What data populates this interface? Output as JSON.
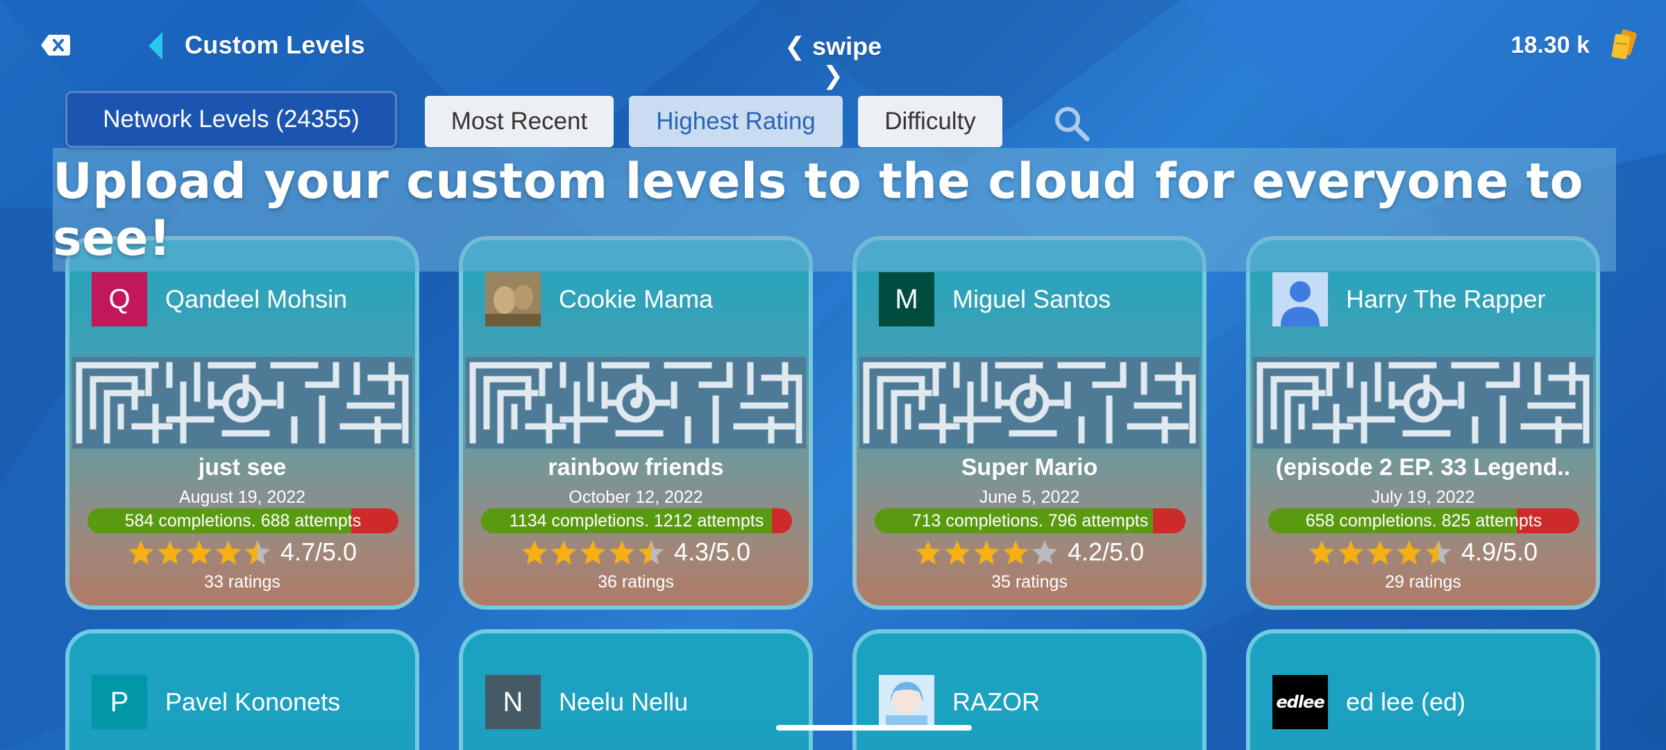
{
  "header": {
    "title": "Custom Levels",
    "swipe": "❮ swipe ❯",
    "currency": "18.30 k"
  },
  "filters": {
    "network": "Network Levels (24355)",
    "tabs": [
      {
        "label": "Most Recent",
        "active": false
      },
      {
        "label": "Highest Rating",
        "active": true
      },
      {
        "label": "Difficulty",
        "active": false
      }
    ]
  },
  "banner": "Upload your custom levels to the cloud for everyone to see!",
  "colors": {
    "accent": "#1c55b0",
    "progress_good": "#5a9a10",
    "progress_bad": "#cf2a2a",
    "star": "#f6b014"
  },
  "levels": [
    {
      "author": "Qandeel Mohsin",
      "avatar_letter": "Q",
      "avatar_color": "#c2185b",
      "title": "just see",
      "date": "August 19, 2022",
      "completions": 584,
      "attempts": 688,
      "progress_text": "584 completions. 688 attempts",
      "rating": 4.7,
      "rating_text": "4.7/5.0",
      "ratings_count": "33 ratings"
    },
    {
      "author": "Cookie Mama",
      "avatar_letter": "",
      "avatar_color": "#8a7350",
      "avatar_icon": "photo-avatar",
      "title": "rainbow friends",
      "date": "October 12, 2022",
      "completions": 1134,
      "attempts": 1212,
      "progress_text": "1134 completions. 1212 attempts",
      "rating": 4.3,
      "rating_text": "4.3/5.0",
      "ratings_count": "36 ratings"
    },
    {
      "author": "Miguel Santos",
      "avatar_letter": "M",
      "avatar_color": "#004d40",
      "title": "Super Mario",
      "date": "June 5, 2022",
      "completions": 713,
      "attempts": 796,
      "progress_text": "713 completions. 796 attempts",
      "rating": 4.2,
      "rating_text": "4.2/5.0",
      "ratings_count": "35 ratings"
    },
    {
      "author": "Harry The Rapper",
      "avatar_letter": "",
      "avatar_color": "#c5dcf6",
      "avatar_icon": "person-avatar",
      "title": "(episode 2 EP. 33 Legend..",
      "date": "July 19, 2022",
      "completions": 658,
      "attempts": 825,
      "progress_text": "658 completions. 825 attempts",
      "rating": 4.9,
      "rating_text": "4.9/5.0",
      "ratings_count": "29 ratings"
    }
  ],
  "levels_row2": [
    {
      "author": "Pavel Kononets",
      "avatar_letter": "P",
      "avatar_color": "#0097a7"
    },
    {
      "author": "Neelu Nellu",
      "avatar_letter": "N",
      "avatar_color": "#455a64"
    },
    {
      "author": "RAZOR",
      "avatar_letter": "",
      "avatar_color": "#d6ecfa",
      "avatar_icon": "anime-avatar"
    },
    {
      "author": "ed lee (ed)",
      "avatar_letter": "",
      "avatar_color": "#000000",
      "avatar_icon": "edlee-logo",
      "logo_text": "edlee"
    }
  ]
}
